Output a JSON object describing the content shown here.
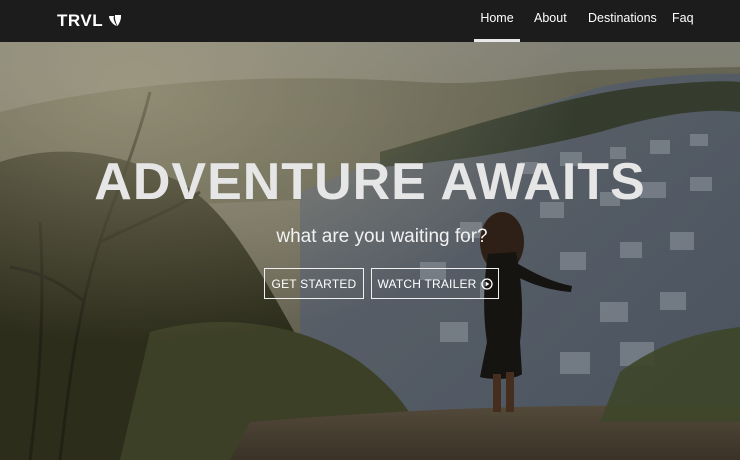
{
  "navbar": {
    "brand": "TRVL",
    "brand_icon": "typo3-logo-icon",
    "links": [
      {
        "label": "Home",
        "active": true
      },
      {
        "label": "About",
        "active": false
      },
      {
        "label": "Destinations",
        "active": false
      },
      {
        "label": "Faq",
        "active": false
      }
    ]
  },
  "hero": {
    "title": "ADVENTURE AWAITS",
    "subtitle": "what are you waiting for?",
    "buttons": {
      "start": "GET STARTED",
      "trailer": "WATCH TRAILER",
      "trailer_icon": "play-circle-icon"
    }
  },
  "colors": {
    "navbar_bg": "#1c1c1c",
    "text": "#ffffff"
  }
}
